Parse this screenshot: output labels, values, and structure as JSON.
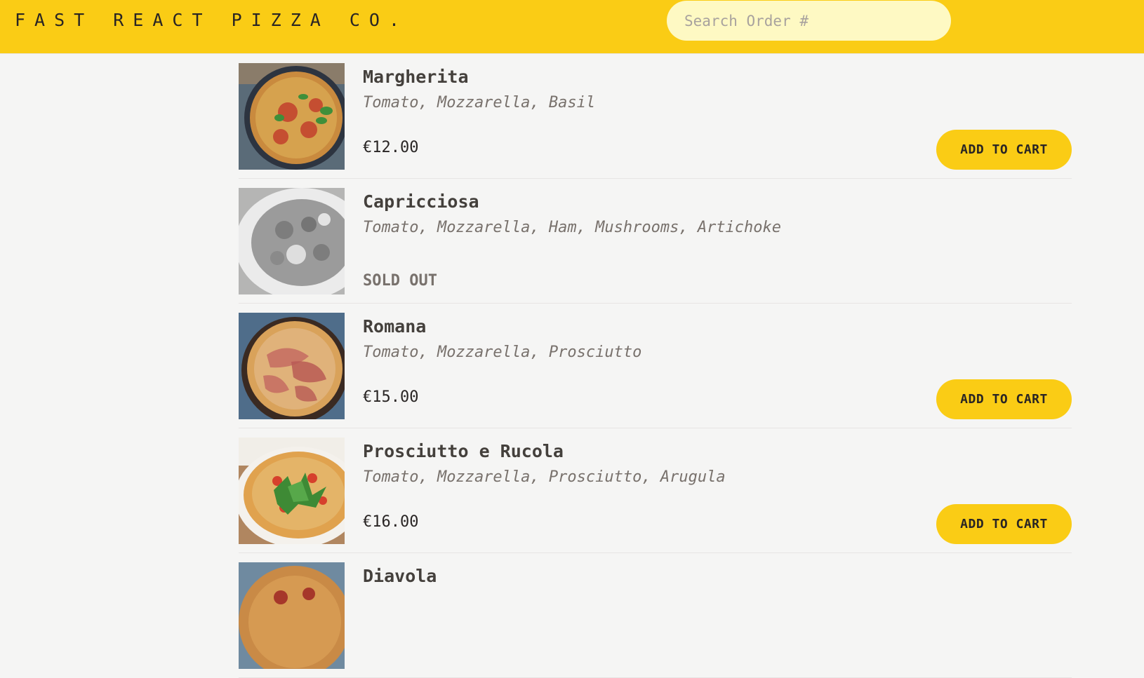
{
  "header": {
    "logo": "Fast React Pizza Co.",
    "search_placeholder": "Search Order #"
  },
  "menu": [
    {
      "name": "Margherita",
      "ingredients": "Tomato, Mozzarella, Basil",
      "price": "€12.00",
      "button": "ADD TO CART",
      "image_icon": "pizza-margherita-photo"
    },
    {
      "name": "Capricciosa",
      "ingredients": "Tomato, Mozzarella, Ham, Mushrooms, Artichoke",
      "status": "SOLD OUT",
      "image_icon": "pizza-capricciosa-photo"
    },
    {
      "name": "Romana",
      "ingredients": "Tomato, Mozzarella, Prosciutto",
      "price": "€15.00",
      "button": "ADD TO CART",
      "image_icon": "pizza-romana-photo"
    },
    {
      "name": "Prosciutto e Rucola",
      "ingredients": "Tomato, Mozzarella, Prosciutto, Arugula",
      "price": "€16.00",
      "button": "ADD TO CART",
      "image_icon": "pizza-prosciutto-rucola-photo"
    },
    {
      "name": "Diavola",
      "image_icon": "pizza-diavola-photo"
    }
  ],
  "colors": {
    "header_bg": "#facc15",
    "search_bg": "#fef9c3",
    "page_bg": "#f5f5f4",
    "button_bg": "#facc15"
  }
}
